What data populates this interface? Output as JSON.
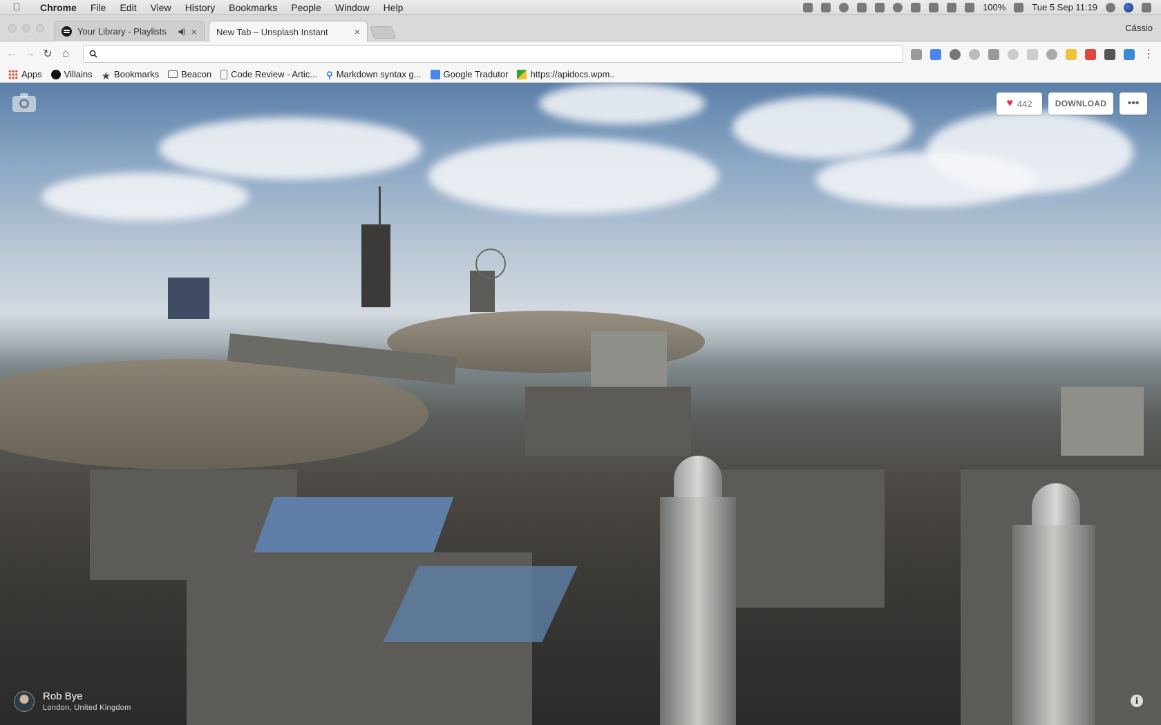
{
  "menubar": {
    "apple": "",
    "items": [
      "Chrome",
      "File",
      "Edit",
      "View",
      "History",
      "Bookmarks",
      "People",
      "Window",
      "Help"
    ],
    "battery": "100%",
    "clock": "Tue 5 Sep  11:19"
  },
  "tabs": [
    {
      "title": "Your Library - Playlists",
      "audio": "◀)",
      "close": "×"
    },
    {
      "title": "New Tab – Unsplash Instant",
      "close": "×"
    }
  ],
  "profile_name": "Cássio",
  "toolbar": {
    "omnibox_value": "",
    "back": "←",
    "forward": "→",
    "reload": "↻",
    "home": "⌂",
    "menu": "⋮"
  },
  "bookmarks": [
    {
      "label": "Apps",
      "icon": "apps-grid-icon"
    },
    {
      "label": "Villains",
      "icon": "spotify-icon"
    },
    {
      "label": "Bookmarks",
      "icon": "star-icon"
    },
    {
      "label": "Beacon",
      "icon": "folder-icon"
    },
    {
      "label": "Code Review - Artic...",
      "icon": "document-icon"
    },
    {
      "label": "Markdown syntax g...",
      "icon": "markdown-icon"
    },
    {
      "label": "Google Tradutor",
      "icon": "google-translate-icon"
    },
    {
      "label": "https://apidocs.wpm..",
      "icon": "api-docs-icon"
    }
  ],
  "photo": {
    "likes": "442",
    "download_label": "DOWNLOAD",
    "more_label": "•••",
    "photographer": "Rob Bye",
    "location": "London, United Kingdom",
    "info": "i"
  },
  "colors": {
    "like_heart": "#e8334a",
    "sky_top": "#5b7fa8"
  }
}
